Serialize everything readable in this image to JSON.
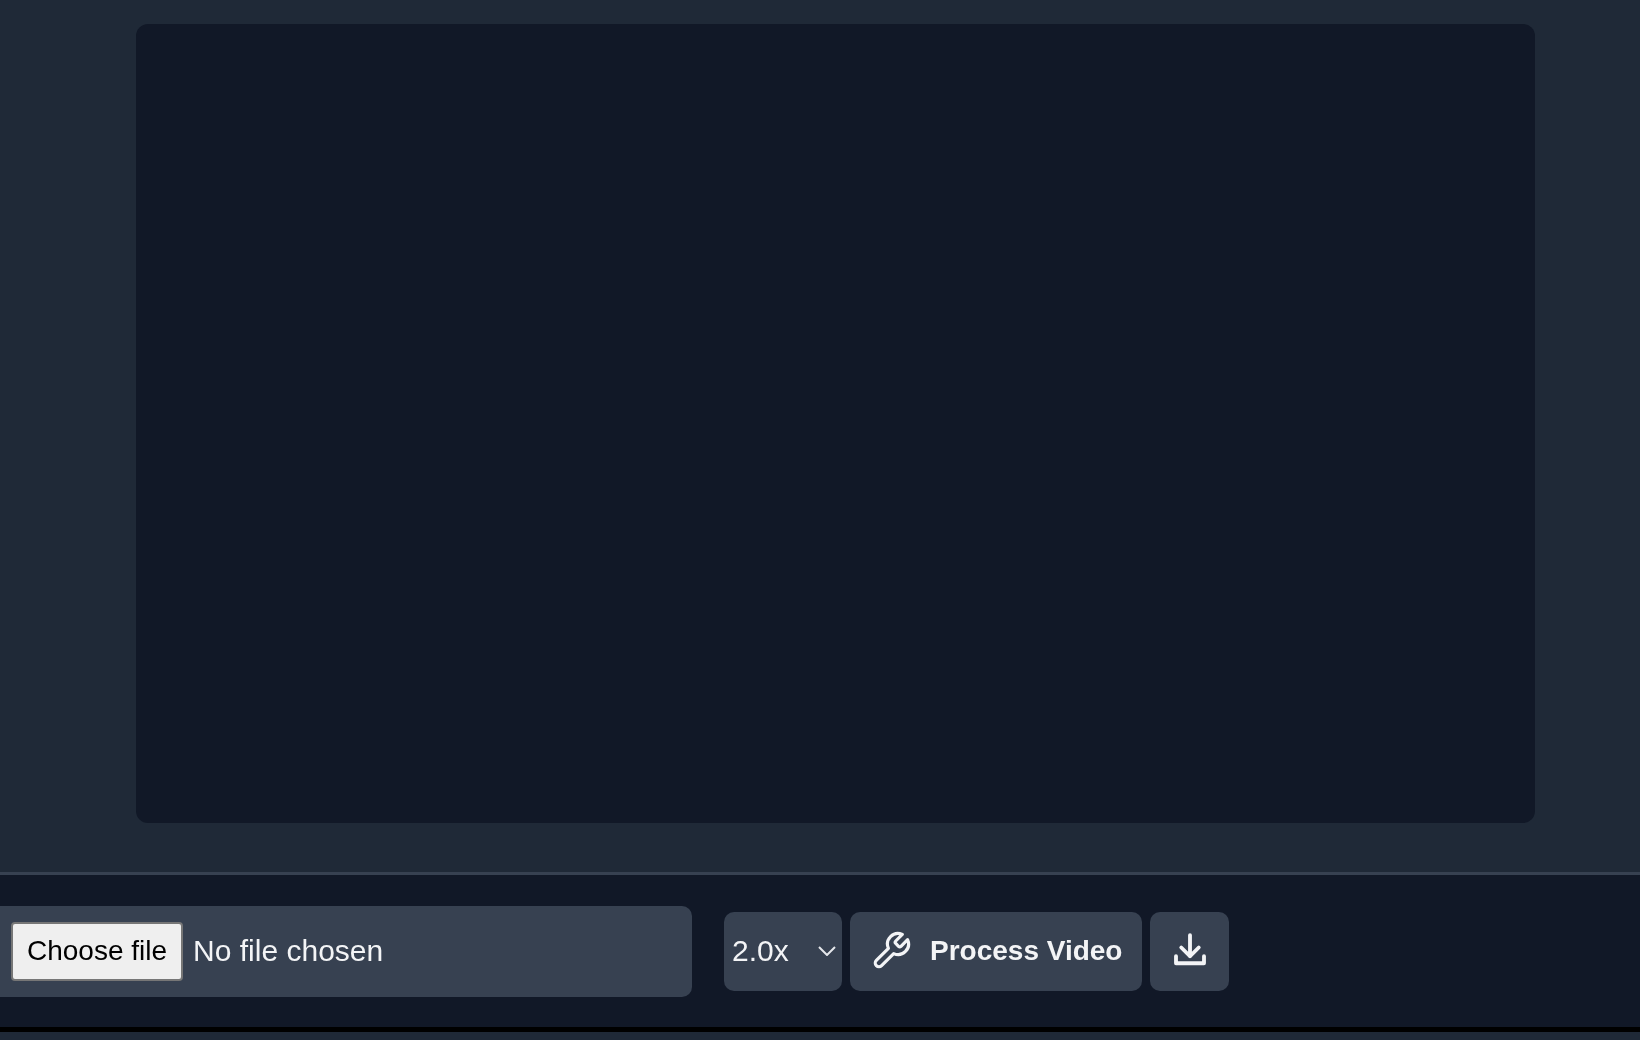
{
  "file_input": {
    "button": "Choose file",
    "status": "No file chosen"
  },
  "speed_select": {
    "value": "2.0x"
  },
  "process_button": {
    "label": "Process Video"
  }
}
